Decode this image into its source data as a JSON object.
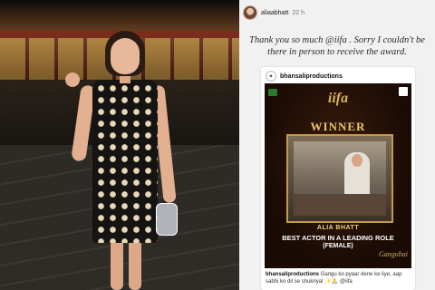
{
  "story": {
    "username": "aliaabhatt",
    "time_ago": "22 h",
    "caption": "Thank you so much @iifa . Sorry I couldn't be there in person to receive the award."
  },
  "post": {
    "username": "bhansaliproductions",
    "poster": {
      "logo": "iifa",
      "title": "WINNER",
      "name": "ALIA BHATT",
      "award_line1": "BEST ACTOR IN A LEADING ROLE",
      "award_line2": "(FEMALE)",
      "film_logo": "Gangubai"
    },
    "caption_user": "bhansaliproductions",
    "caption_text": "Gangu ko pyaar dene ke liye, aap sabhi ko dil se shukriya! ✨🙏 @iifa"
  },
  "colors": {
    "story_bg": "#f1f1f1",
    "poster_gold": "#e9c56a",
    "poster_bg": "#1a0b04"
  }
}
